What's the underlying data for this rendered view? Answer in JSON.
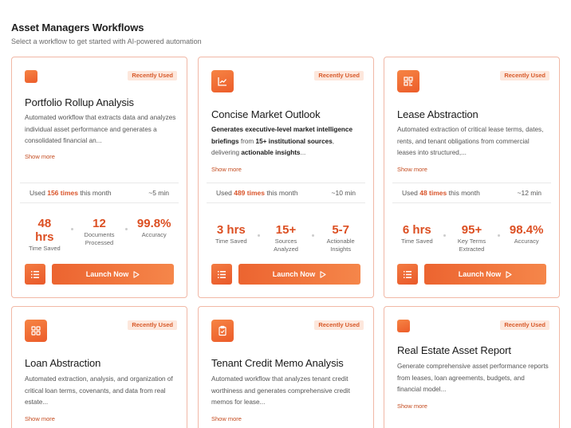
{
  "header": {
    "title": "Asset Managers Workflows",
    "subtitle": "Select a workflow to get started with AI-powered automation"
  },
  "labels": {
    "badge": "Recently Used",
    "show_more": "Show more",
    "used_prefix": "Used",
    "used_suffix": "this month",
    "launch": "Launch Now"
  },
  "cards": [
    {
      "title": "Portfolio Rollup Analysis",
      "desc": "Automated workflow that extracts data and analyzes individual asset performance and generates a consolidated financial an...",
      "used_count": "156 times",
      "duration": "~5 min",
      "stats": [
        {
          "value": "48 hrs",
          "label": "Time Saved"
        },
        {
          "value": "12",
          "label": "Documents Processed"
        },
        {
          "value": "99.8%",
          "label": "Accuracy"
        }
      ]
    },
    {
      "title": "Concise Market Outlook",
      "desc_parts": [
        "Generates executive-level market intelligence briefings",
        " from ",
        "15+ institutional sources",
        ", delivering ",
        "actionable insights",
        "..."
      ],
      "used_count": "489 times",
      "duration": "~10 min",
      "stats": [
        {
          "value": "3 hrs",
          "label": "Time Saved"
        },
        {
          "value": "15+",
          "label": "Sources Analyzed"
        },
        {
          "value": "5-7",
          "label": "Actionable Insights"
        }
      ]
    },
    {
      "title": "Lease Abstraction",
      "desc": "Automated extraction of critical lease terms, dates, rents, and tenant obligations from commercial leases into structured,...",
      "used_count": "48 times",
      "duration": "~12 min",
      "stats": [
        {
          "value": "6 hrs",
          "label": "Time Saved"
        },
        {
          "value": "95+",
          "label": "Key Terms Extracted"
        },
        {
          "value": "98.4%",
          "label": "Accuracy"
        }
      ]
    },
    {
      "title": "Loan Abstraction",
      "desc": "Automated extraction, analysis, and organization of critical loan terms, covenants, and data from real estate..."
    },
    {
      "title": "Tenant Credit Memo Analysis",
      "desc": "Automated workflow that analyzes tenant credit worthiness and generates comprehensive credit memos for lease..."
    },
    {
      "title": "Real Estate Asset Report",
      "desc": "Generate comprehensive asset performance reports from leases, loan agreements, budgets, and financial model..."
    }
  ],
  "icons": {
    "card_1": "square-icon",
    "card_2": "line-chart-icon",
    "card_3": "scan-icon",
    "card_4": "grid-icon",
    "card_5": "clipboard-icon",
    "card_6": "square-icon",
    "list": "list-icon",
    "launch": "play-icon"
  },
  "colors": {
    "accent": "#ec5c2a",
    "badge_bg": "#fde7dc",
    "card_border": "#f1b8a6"
  }
}
